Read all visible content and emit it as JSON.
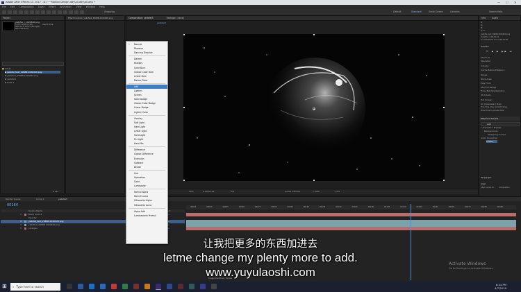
{
  "window": {
    "title": "Adobe After Effects CC 2017 - D:\\~~Motion Design.ddy\\all.ddy\\all.aep *",
    "controls": [
      "—",
      "☐",
      "✕"
    ]
  },
  "menubar": {
    "items": [
      "File",
      "Edit",
      "Composition",
      "Layer",
      "Effect",
      "Animation",
      "View",
      "Window",
      "Help"
    ]
  },
  "toolbar": {
    "snapping": "Snapping",
    "workspaces": [
      "Default",
      "Standard",
      "Small Screen",
      "Libraries"
    ],
    "search": "Search Help"
  },
  "project": {
    "title": "Project",
    "selected_name": "yellofei -- 1020420.png",
    "selected_info": [
      "used 1 time",
      "1920 x 1080 (1.00)",
      "Millions of Colors (Straight)",
      "Non-Interlaced"
    ],
    "items": [
      {
        "name": "Solids",
        "type": "folder"
      },
      {
        "name": "yellofei_text_29688-1020420.png",
        "type": "file",
        "selected": true
      },
      {
        "name": "yellofei2_29688-1020420.png",
        "type": "file"
      },
      {
        "name": "yellofei3",
        "type": "comp"
      },
      {
        "name": "Solid 1",
        "type": "solid"
      }
    ],
    "bpc": "8 bpc"
  },
  "effect_controls": {
    "title": "Effect Controls: yellofei2_29688-1020420.png"
  },
  "composition": {
    "tab_active": "Composition: yellofei3",
    "tab_other": "Footage: (none)",
    "crumb": "yellofei3",
    "footer": {
      "zoom": "50%",
      "time": "0;00;00;14",
      "resolution": "Full",
      "camera": "Active Camera",
      "views": "1 View",
      "offset": "+0.0"
    }
  },
  "blend_menu": {
    "selected": "Add",
    "groups": [
      [
        "Normal",
        "Dissolve",
        "Dancing Dissolve"
      ],
      [
        "Darken",
        "Multiply",
        "Color Burn",
        "Classic Color Burn",
        "Linear Burn",
        "Darker Color"
      ],
      [
        "Add",
        "Lighten",
        "Screen",
        "Color Dodge",
        "Classic Color Dodge",
        "Linear Dodge",
        "Lighter Color"
      ],
      [
        "Overlay",
        "Soft Light",
        "Hard Light",
        "Linear Light",
        "Vivid Light",
        "Pin Light",
        "Hard Mix"
      ],
      [
        "Difference",
        "Classic Difference",
        "Exclusion",
        "Subtract",
        "Divide"
      ],
      [
        "Hue",
        "Saturation",
        "Color",
        "Luminosity"
      ],
      [
        "Stencil Alpha",
        "Stencil Luma",
        "Silhouette Alpha",
        "Silhouette Luma"
      ],
      [
        "Alpha Add",
        "Luminescent Premul"
      ]
    ]
  },
  "right_panel": {
    "tabs": [
      "Info",
      "Audio"
    ],
    "info": [
      "R:",
      "G:",
      "B:",
      "A: 0"
    ],
    "info_footage": [
      "yellofei_text_29688-1020420.png",
      "Duration: 0;00;10;01",
      "In: 0;00;00;00, Out: 0;00;10;00"
    ],
    "preview_title": "Preview",
    "preview_rows": [
      "Shortcut",
      "Spacebar",
      "Include:",
      "Cache Before Playback",
      "Range",
      "Work Area",
      "Play From",
      "Start Of Range",
      "Frame Rate   Skip   Resolution",
      "30   0   Auto",
      "Full Screen",
      "On (Spacebar) Stop:",
      "If caching, play cached frames",
      "Move time to preview time"
    ],
    "effects_title": "Effects & Presets",
    "effects_search": "add",
    "effects_rows": [
      "* Animation Presets",
      "Backgrounds",
      "Sweeping Curves",
      "Color Correction",
      "Levels"
    ],
    "paragraph_title": "Paragraph",
    "align_title": "Align",
    "align_rows": [
      "Align Layers to:",
      "Composition"
    ]
  },
  "timeline": {
    "tabs": [
      "Render Queue",
      "Comp 1",
      "yellofei3"
    ],
    "timecode": "00164",
    "columns": [
      "Source Name",
      "Mode",
      "T",
      "TrkMat",
      "Parent"
    ],
    "layers": [
      {
        "num": "1",
        "name": "Black Solid 2",
        "mode": "Normal",
        "trkmat": "",
        "parent": "None",
        "color": "#b96e6e"
      },
      {
        "num": "2",
        "name": "Opacity",
        "mode": "",
        "trkmat": "",
        "parent": "",
        "color": "#8f9fb0"
      },
      {
        "num": "3",
        "name": "yellofei_text_29688-1020420.png",
        "mode": "Normal",
        "trkmat": "None",
        "parent": "None",
        "color": "#7aa3ad"
      },
      {
        "num": "4",
        "name": "yellofei2_29688-1020420.png",
        "mode": "Normal",
        "trkmat": "None",
        "parent": "None",
        "color": "#7aa3ad"
      },
      {
        "num": "5",
        "name": "yarlaybo",
        "mode": "Normal",
        "trkmat": "None",
        "parent": "None",
        "color": "#b96e6e"
      }
    ],
    "ruler": [
      "00015",
      "00030",
      "00045",
      "00060",
      "00075",
      "00090",
      "00105",
      "00120",
      "00135",
      "00150",
      "00165",
      "00180",
      "00195",
      "00210",
      "00225",
      "00240",
      "00255",
      "00270",
      "00285",
      "00300"
    ],
    "toggle": "Toggle Switches / Modes"
  },
  "subtitles": {
    "chinese": "让我把更多的东西加进去",
    "english": "letme change my plenty more to add.",
    "url": "www.yuyulaoshi.com"
  },
  "watermark": {
    "line1": "Activate Windows",
    "line2": "Go to Settings to activate Windows."
  },
  "taskbar": {
    "search": "Type here to search",
    "time": "8:44 PM",
    "date": "4/7/2019"
  }
}
